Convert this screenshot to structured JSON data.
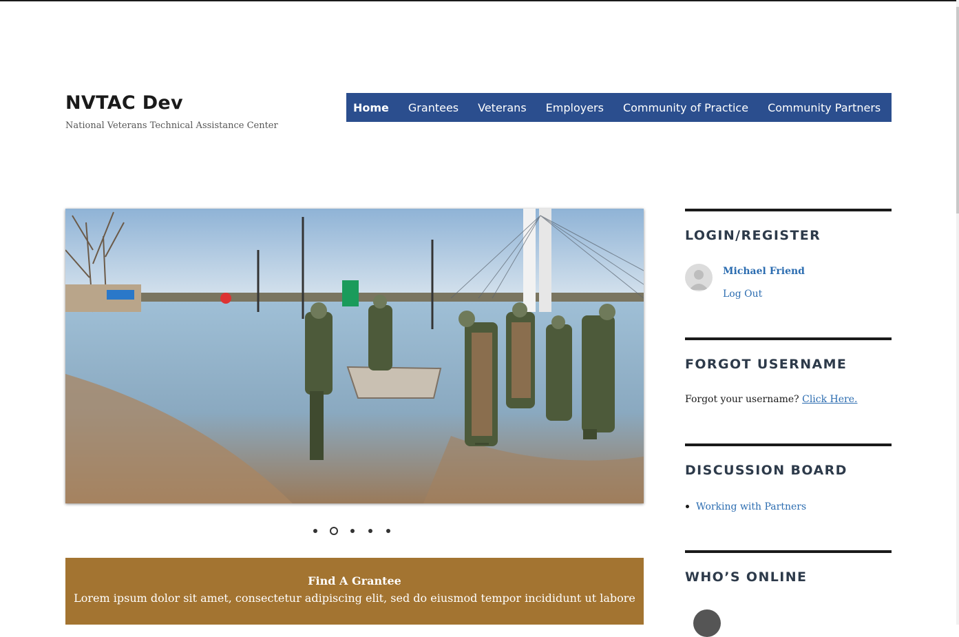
{
  "site": {
    "title": "NVTAC Dev",
    "description": "National Veterans Technical Assistance Center"
  },
  "nav": {
    "items": [
      {
        "label": "Home",
        "active": true
      },
      {
        "label": "Grantees",
        "active": false
      },
      {
        "label": "Veterans",
        "active": false
      },
      {
        "label": "Employers",
        "active": false
      },
      {
        "label": "Community of Practice",
        "active": false
      },
      {
        "label": "Community Partners",
        "active": false
      }
    ],
    "bg_color": "#2b4e8e"
  },
  "slider": {
    "image_alt": "Soldiers in waders walking through flooded street with a boat",
    "dots_count": 5,
    "active_dot": 2
  },
  "feature_box": {
    "title": "Find A Grantee",
    "text": "Lorem ipsum dolor sit amet, consectetur adipiscing elit, sed do eiusmod tempor incididunt ut labore",
    "bg_color": "#a37431"
  },
  "sidebar": {
    "login": {
      "title": "LOGIN/REGISTER",
      "user_name": "Michael Friend",
      "logout_label": "Log Out"
    },
    "forgot": {
      "title": "FORGOT USERNAME",
      "text": "Forgot your username?",
      "link_label": "Click Here."
    },
    "discussion": {
      "title": "DISCUSSION BOARD",
      "items": [
        "Working with Partners"
      ]
    },
    "online": {
      "title": "WHO’S ONLINE"
    }
  },
  "colors": {
    "link": "#2b6cb0",
    "widget_title": "#2d3a4a"
  }
}
